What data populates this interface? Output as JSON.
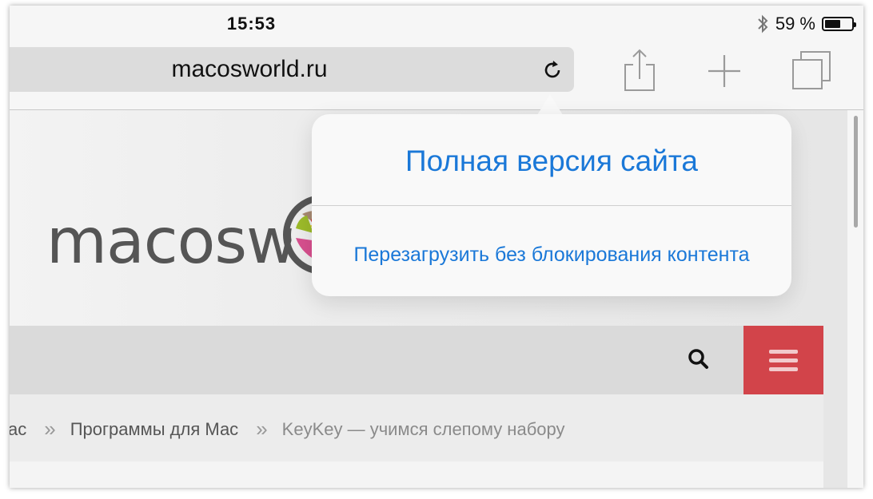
{
  "status_bar": {
    "time": "15:53",
    "battery_text": "59 %",
    "battery_level": 0.59,
    "icons": [
      "bluetooth-icon",
      "battery-icon"
    ]
  },
  "toolbar": {
    "url": "macosworld.ru",
    "icons": [
      "reload-icon",
      "share-icon",
      "new-tab-icon",
      "tabs-icon"
    ]
  },
  "popover": {
    "primary_action": "Полная версия сайта",
    "secondary_action": "Перезагрузить без блокирования контента"
  },
  "page": {
    "logo_text": "macosw",
    "breadcrumb": [
      {
        "label": "ac"
      },
      {
        "label": "Программы для Мас"
      },
      {
        "label": "KeyKey — учимся слепому набору"
      }
    ],
    "breadcrumb_separator": "»",
    "icons": [
      "search-icon",
      "hamburger-menu-icon"
    ]
  },
  "colors": {
    "link_blue": "#1a78d8",
    "menu_red": "#d2444a"
  }
}
